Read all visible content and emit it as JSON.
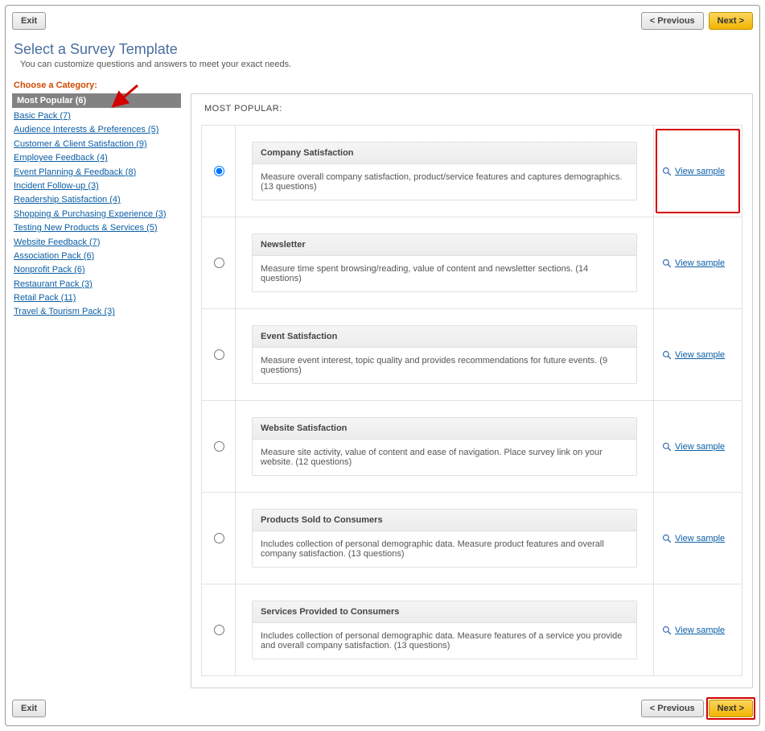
{
  "buttons": {
    "exit": "Exit",
    "previous": "< Previous",
    "next": "Next >"
  },
  "page": {
    "title": "Select a Survey Template",
    "subtitle": "You can customize questions and answers to meet your exact needs.",
    "choose_category": "Choose a Category:",
    "panel_heading": "MOST POPULAR:"
  },
  "sidebar": {
    "selected": "Most Popular (6)",
    "items": [
      "Basic Pack (7)",
      "Audience Interests & Preferences (5)",
      "Customer & Client Satisfaction (9)",
      "Employee Feedback (4)",
      "Event Planning & Feedback (8)",
      "Incident Follow-up (3)",
      "Readership Satisfaction (4)",
      "Shopping & Purchasing Experience (3)",
      "Testing New Products & Services (5)",
      "Website Feedback (7)",
      "Association Pack (6)",
      "Nonprofit Pack (6)",
      "Restaurant Pack (3)",
      "Retail Pack (11)",
      "Travel & Tourism Pack (3)"
    ]
  },
  "templates": [
    {
      "title": "Company Satisfaction",
      "desc": "Measure overall company satisfaction, product/service features and captures demographics. (13 questions)",
      "link": "View sample",
      "selected": true,
      "highlight": true
    },
    {
      "title": "Newsletter",
      "desc": "Measure time spent browsing/reading, value of content and newsletter sections. (14 questions)",
      "link": "View sample",
      "selected": false
    },
    {
      "title": "Event Satisfaction",
      "desc": "Measure event interest, topic quality and provides recommendations for future events. (9 questions)",
      "link": "View sample",
      "selected": false
    },
    {
      "title": "Website Satisfaction",
      "desc": "Measure site activity, value of content and ease of navigation. Place survey link on your website. (12 questions)",
      "link": "View sample",
      "selected": false
    },
    {
      "title": "Products Sold to Consumers",
      "desc": "Includes collection of personal demographic data. Measure product features and overall company satisfaction. (13 questions)",
      "link": "View sample",
      "selected": false
    },
    {
      "title": "Services Provided to Consumers",
      "desc": "Includes collection of personal demographic data. Measure features of a service you provide and overall company satisfaction. (13 questions)",
      "link": "View sample",
      "selected": false
    }
  ]
}
